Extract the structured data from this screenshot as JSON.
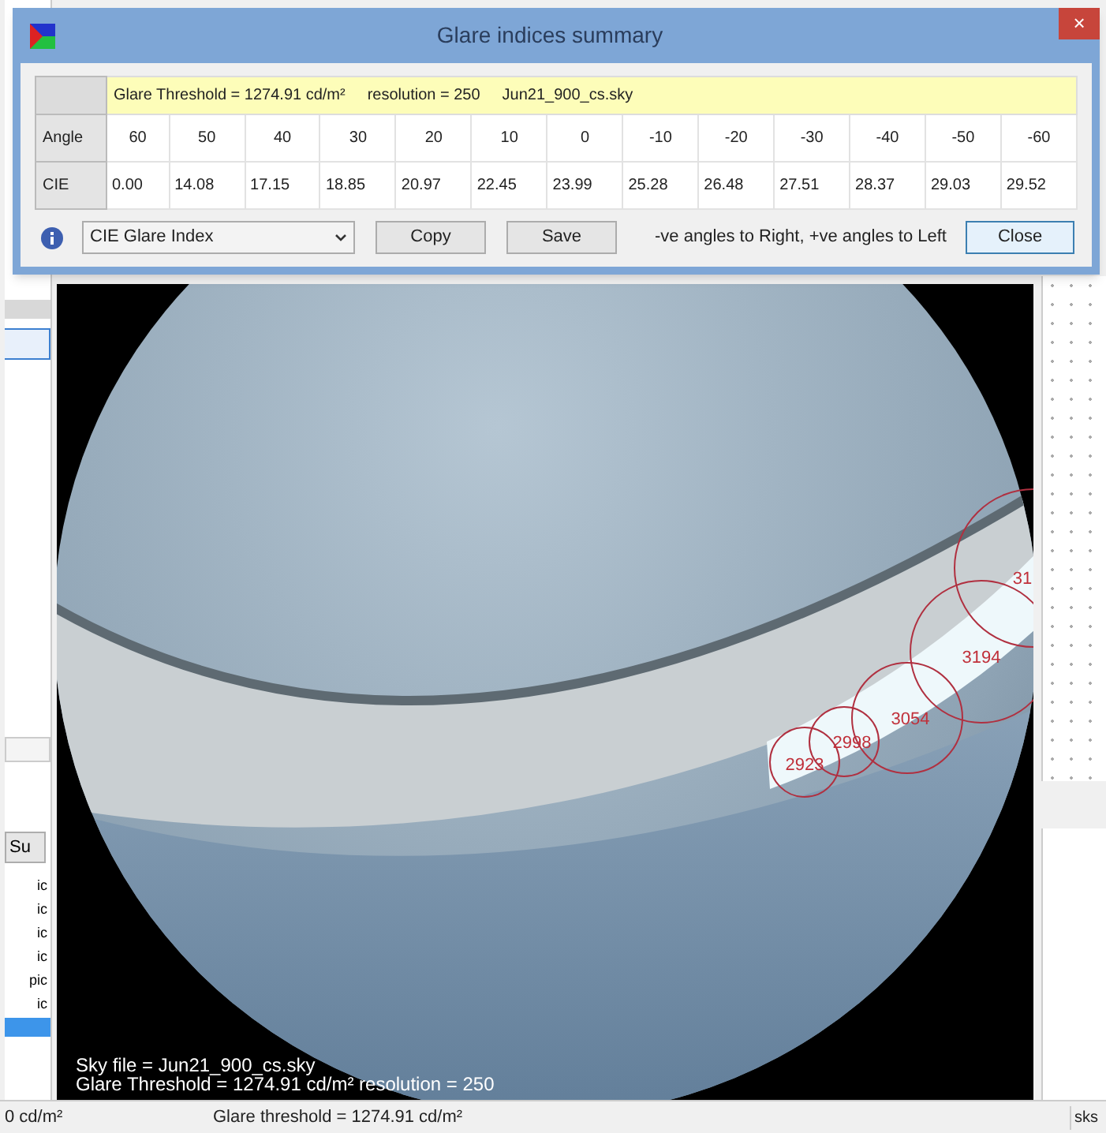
{
  "dialog": {
    "title": "Glare indices summary",
    "close_glyph": "×",
    "info": {
      "threshold": "Glare Threshold = 1274.91 cd/m²",
      "resolution": "resolution = 250",
      "sky_file": "Jun21_900_cs.sky"
    },
    "rows": [
      {
        "label": "Angle",
        "values": [
          "60",
          "50",
          "40",
          "30",
          "20",
          "10",
          "0",
          "-10",
          "-20",
          "-30",
          "-40",
          "-50",
          "-60"
        ]
      },
      {
        "label": "CIE",
        "values": [
          "0.00",
          "14.08",
          "17.15",
          "18.85",
          "20.97",
          "22.45",
          "23.99",
          "25.28",
          "26.48",
          "27.51",
          "28.37",
          "29.03",
          "29.52"
        ]
      }
    ],
    "index_select": {
      "value": "CIE Glare Index"
    },
    "buttons": [
      "Copy",
      "Save"
    ],
    "note": "-ve angles to Right, +ve angles to Left",
    "close_button": "Close"
  },
  "left_panel": {
    "tab_label": "Su",
    "list_items": [
      "ic",
      "ic",
      "ic",
      "ic",
      "pic",
      "ic"
    ]
  },
  "render": {
    "overlay_lines": [
      "Sky file = Jun21_900_cs.sky",
      "Glare Threshold = 1274.91 cd/m²  resolution = 250"
    ],
    "glare_sources": [
      {
        "label": "2923"
      },
      {
        "label": "2998"
      },
      {
        "label": "3054"
      },
      {
        "label": "3194"
      },
      {
        "label": "31"
      }
    ]
  },
  "right_panel": {
    "tab_label": "sks"
  },
  "status_bar": [
    "0 cd/m²",
    "Glare threshold = 1274.91 cd/m²"
  ]
}
